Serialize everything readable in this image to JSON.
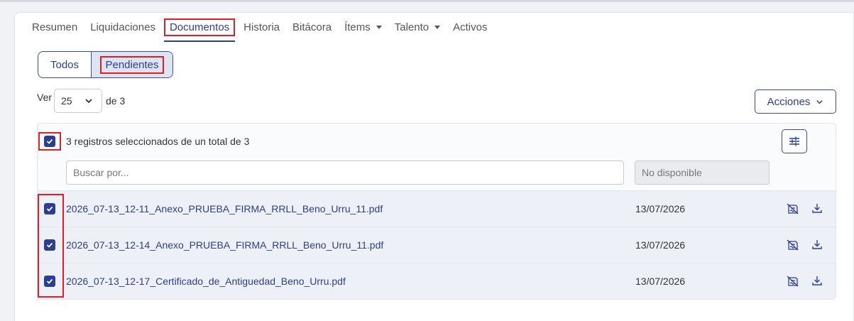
{
  "tabs": [
    {
      "label": "Resumen"
    },
    {
      "label": "Liquidaciones"
    },
    {
      "label": "Documentos"
    },
    {
      "label": "Historia"
    },
    {
      "label": "Bitácora"
    },
    {
      "label": "Ítems"
    },
    {
      "label": "Talento"
    },
    {
      "label": "Activos"
    }
  ],
  "active_tab": "Documentos",
  "filter": {
    "todos": "Todos",
    "pendientes": "Pendientes",
    "active": "Pendientes"
  },
  "pager": {
    "ver": "Ver",
    "page_size": "25",
    "of": "de 3"
  },
  "acciones": "Acciones",
  "selection_text": "3 registros seleccionados de un total de 3",
  "search": {
    "placeholder": "Buscar por...",
    "value": ""
  },
  "date_filter": "No disponible",
  "rows": [
    {
      "file": "2026_07-13_12-11_Anexo_PRUEBA_FIRMA_RRLL_Beno_Urru_11.pdf",
      "date": "13/07/2026",
      "checked": true
    },
    {
      "file": "2026_07-13_12-14_Anexo_PRUEBA_FIRMA_RRLL_Beno_Urru_11.pdf",
      "date": "13/07/2026",
      "checked": true
    },
    {
      "file": "2026_07-13_12-17_Certificado_de_Antiguedad_Beno_Urru.pdf",
      "date": "13/07/2026",
      "checked": true
    }
  ],
  "colors": {
    "primary": "#2c3e8f",
    "highlight": "#e21f26",
    "row_bg": "#eef0f7"
  },
  "icons": {
    "row_action_1": "sign-document-icon",
    "row_action_2": "download-icon",
    "filter": "sliders-icon"
  }
}
